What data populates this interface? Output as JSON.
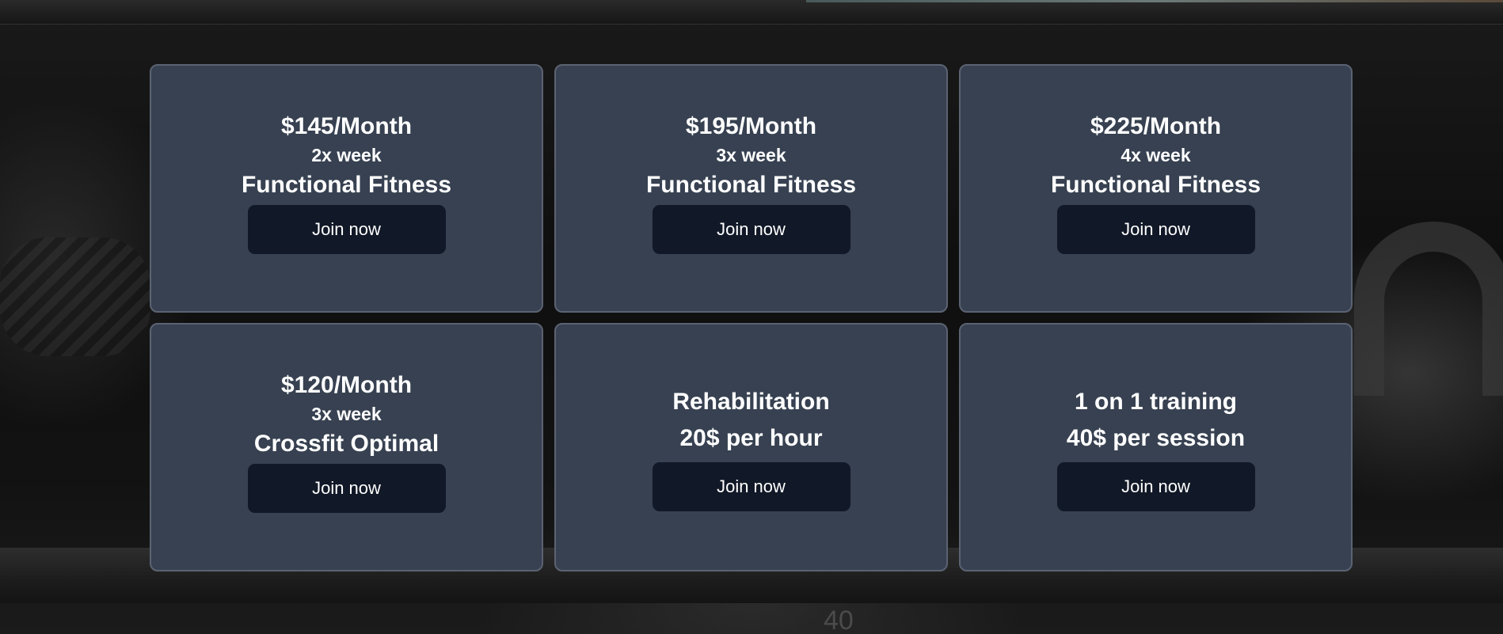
{
  "background": {
    "weight_marking": "40"
  },
  "plans": [
    {
      "price": "$145/Month",
      "frequency": "2x week",
      "program": "Functional Fitness",
      "button_label": "Join now"
    },
    {
      "price": "$195/Month",
      "frequency": "3x week",
      "program": "Functional Fitness",
      "button_label": "Join now"
    },
    {
      "price": "$225/Month",
      "frequency": "4x week",
      "program": "Functional Fitness",
      "button_label": "Join now"
    },
    {
      "price": "$120/Month",
      "frequency": "3x week",
      "program": "Crossfit Optimal",
      "button_label": "Join now"
    },
    {
      "title": "Rehabilitation",
      "rate": "20$ per hour",
      "button_label": "Join now"
    },
    {
      "title": "1 on 1 training",
      "rate": "40$ per session",
      "button_label": "Join now"
    }
  ],
  "colors": {
    "card_background": "#374151",
    "card_border": "#5b6372",
    "button_background": "#111827",
    "text": "#ffffff"
  }
}
